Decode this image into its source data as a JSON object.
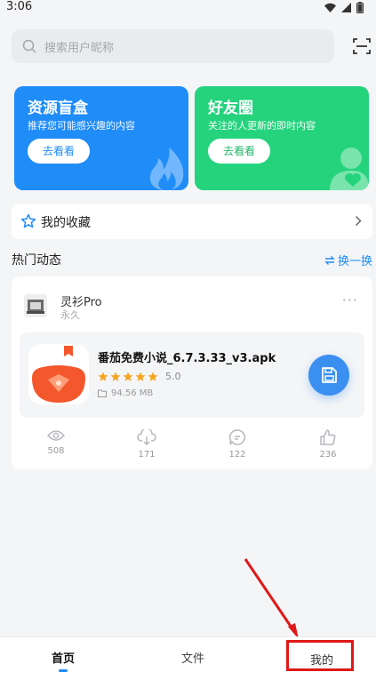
{
  "status": {
    "time": "3:06"
  },
  "search": {
    "placeholder": "搜索用户昵称"
  },
  "cards": [
    {
      "title": "资源盲盒",
      "subtitle": "推荐您可能感兴趣的内容",
      "button": "去看看",
      "color": "#1f8cf8"
    },
    {
      "title": "好友圈",
      "subtitle": "关注的人更新的即时内容",
      "button": "去看看",
      "color": "#25d37d"
    }
  ],
  "favorites": {
    "label": "我的收藏"
  },
  "section": {
    "title": "热门动态",
    "refresh": "换一换"
  },
  "post": {
    "user": "灵衫Pro",
    "subtitle": "永久",
    "app": {
      "name": "番茄免费小说_6.7.3.33_v3.apk",
      "rating": "5.0",
      "stars": 5,
      "size": "94.56 MB"
    },
    "stats": {
      "views": "508",
      "downloads": "171",
      "comments": "122",
      "likes": "236"
    }
  },
  "nav": {
    "home": "首页",
    "files": "文件",
    "mine": "我的"
  },
  "colors": {
    "accent": "#1f8cf8",
    "green": "#25d37d",
    "highlight": "#e01818",
    "star": "#f5a623"
  }
}
